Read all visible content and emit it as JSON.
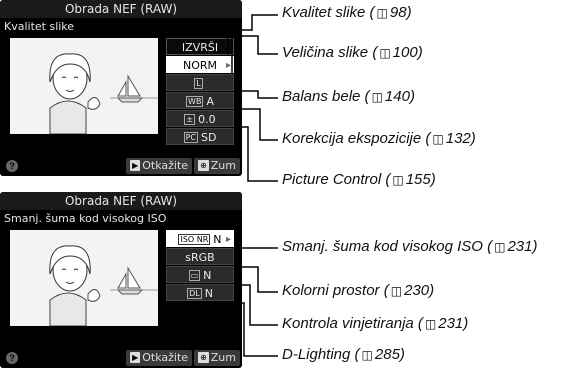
{
  "screen1": {
    "title": "Obrada NEF (RAW)",
    "subtitle": "Kvalitet slike",
    "menu": {
      "execute": "IZVRŠI",
      "quality": "NORM",
      "size_icon": "L",
      "wb_value": "A",
      "exposure_value": "0.0",
      "picture_control": "SD"
    },
    "footer": {
      "cancel": "Otkažite",
      "zoom": "Zum"
    }
  },
  "screen2": {
    "title": "Obrada NEF (RAW)",
    "subtitle": "Smanj. šuma kod visokog ISO",
    "menu": {
      "high_iso_nr": "N",
      "color_space": "sRGB",
      "vignette": "N",
      "d_lighting": "N"
    },
    "footer": {
      "cancel": "Otkažite",
      "zoom": "Zum"
    }
  },
  "callouts": [
    {
      "label": "Kvalitet slike (",
      "page": "98"
    },
    {
      "label": "Veličina slike (",
      "page": "100"
    },
    {
      "label": "Balans bele (",
      "page": "140"
    },
    {
      "label": "Korekcija ekspozicije (",
      "page": "132"
    },
    {
      "label": "Picture Control (",
      "page": "155"
    },
    {
      "label": "Smanj. šuma kod visokog ISO (",
      "page": "231"
    },
    {
      "label": "Kolorni prostor (",
      "page": "230"
    },
    {
      "label": "Kontrola vinjetiranja (",
      "page": "231"
    },
    {
      "label": "D-Lighting (",
      "page": "285"
    }
  ],
  "help_symbol": "?",
  "book_symbol": "◫"
}
